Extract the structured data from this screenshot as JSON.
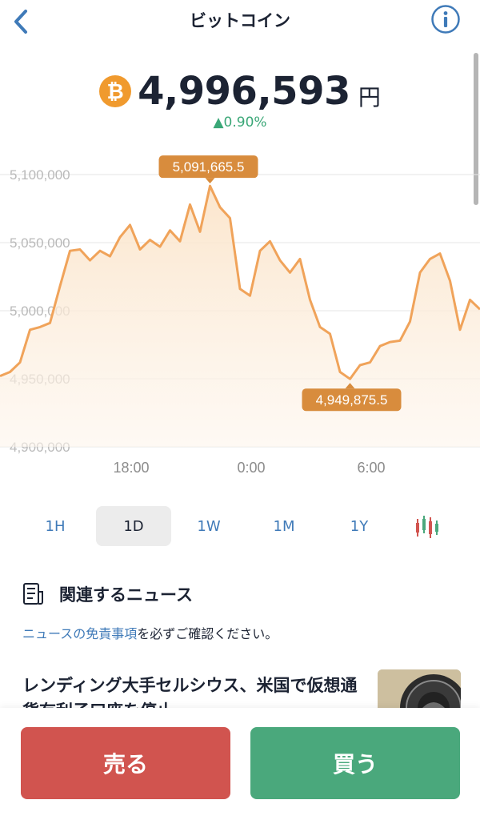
{
  "header": {
    "title": "ビットコイン"
  },
  "price": {
    "symbol": "₿",
    "value": "4,996,593",
    "unit": "円",
    "change": "▲0.90%"
  },
  "chart_data": {
    "type": "area",
    "x_ticks": [
      "18:00",
      "0:00",
      "6:00"
    ],
    "y_ticks": [
      "5,100,000",
      "5,050,000",
      "5,000,000",
      "4,950,000",
      "4,900,000"
    ],
    "ylim": [
      4900000,
      5120000
    ],
    "grid": true,
    "series": [
      {
        "values": [
          4952000,
          4955000,
          4962000,
          4986000,
          4988000,
          4991000,
          5018000,
          5044000,
          5045000,
          5037000,
          5044000,
          5040000,
          5054000,
          5063000,
          5045000,
          5052000,
          5047000,
          5059000,
          5051000,
          5078000,
          5058000,
          5091665.5,
          5076000,
          5068000,
          5016000,
          5011000,
          5044000,
          5051000,
          5037000,
          5028000,
          5038000,
          5008000,
          4988000,
          4983000,
          4955000,
          4949875.5,
          4960000,
          4962000,
          4974000,
          4977000,
          4978000,
          4992000,
          5028000,
          5038000,
          5042000,
          5022000,
          4986000,
          5008000,
          5001000
        ]
      }
    ],
    "annotations": [
      {
        "label": "5,091,665.5",
        "value": 5091665.5,
        "type": "max"
      },
      {
        "label": "4,949,875.5",
        "value": 4949875.5,
        "type": "min"
      }
    ],
    "line_color": "#f0a35a"
  },
  "range_tabs": [
    {
      "label": "1H",
      "active": false
    },
    {
      "label": "1D",
      "active": true
    },
    {
      "label": "1W",
      "active": false
    },
    {
      "label": "1M",
      "active": false
    },
    {
      "label": "1Y",
      "active": false
    }
  ],
  "icons": {
    "back": "chevron-left-icon",
    "info": "info-icon",
    "candle": "candlestick-icon",
    "news": "newspaper-icon",
    "coin": "bitcoin-icon"
  },
  "news": {
    "title": "関連するニュース",
    "disclaimer_link": "ニュースの免責事項",
    "disclaimer_rest": "を必ずご確認ください。",
    "items": [
      {
        "headline": "レンディング大手セルシウス、米国で仮想通貨有利子口座を停止"
      }
    ]
  },
  "actions": {
    "sell": "売る",
    "buy": "買う"
  },
  "colors": {
    "accent": "#3f7ab8",
    "sell": "#d1544f",
    "buy": "#4aa87c",
    "up": "#3aa777",
    "btc": "#f09a2e"
  }
}
